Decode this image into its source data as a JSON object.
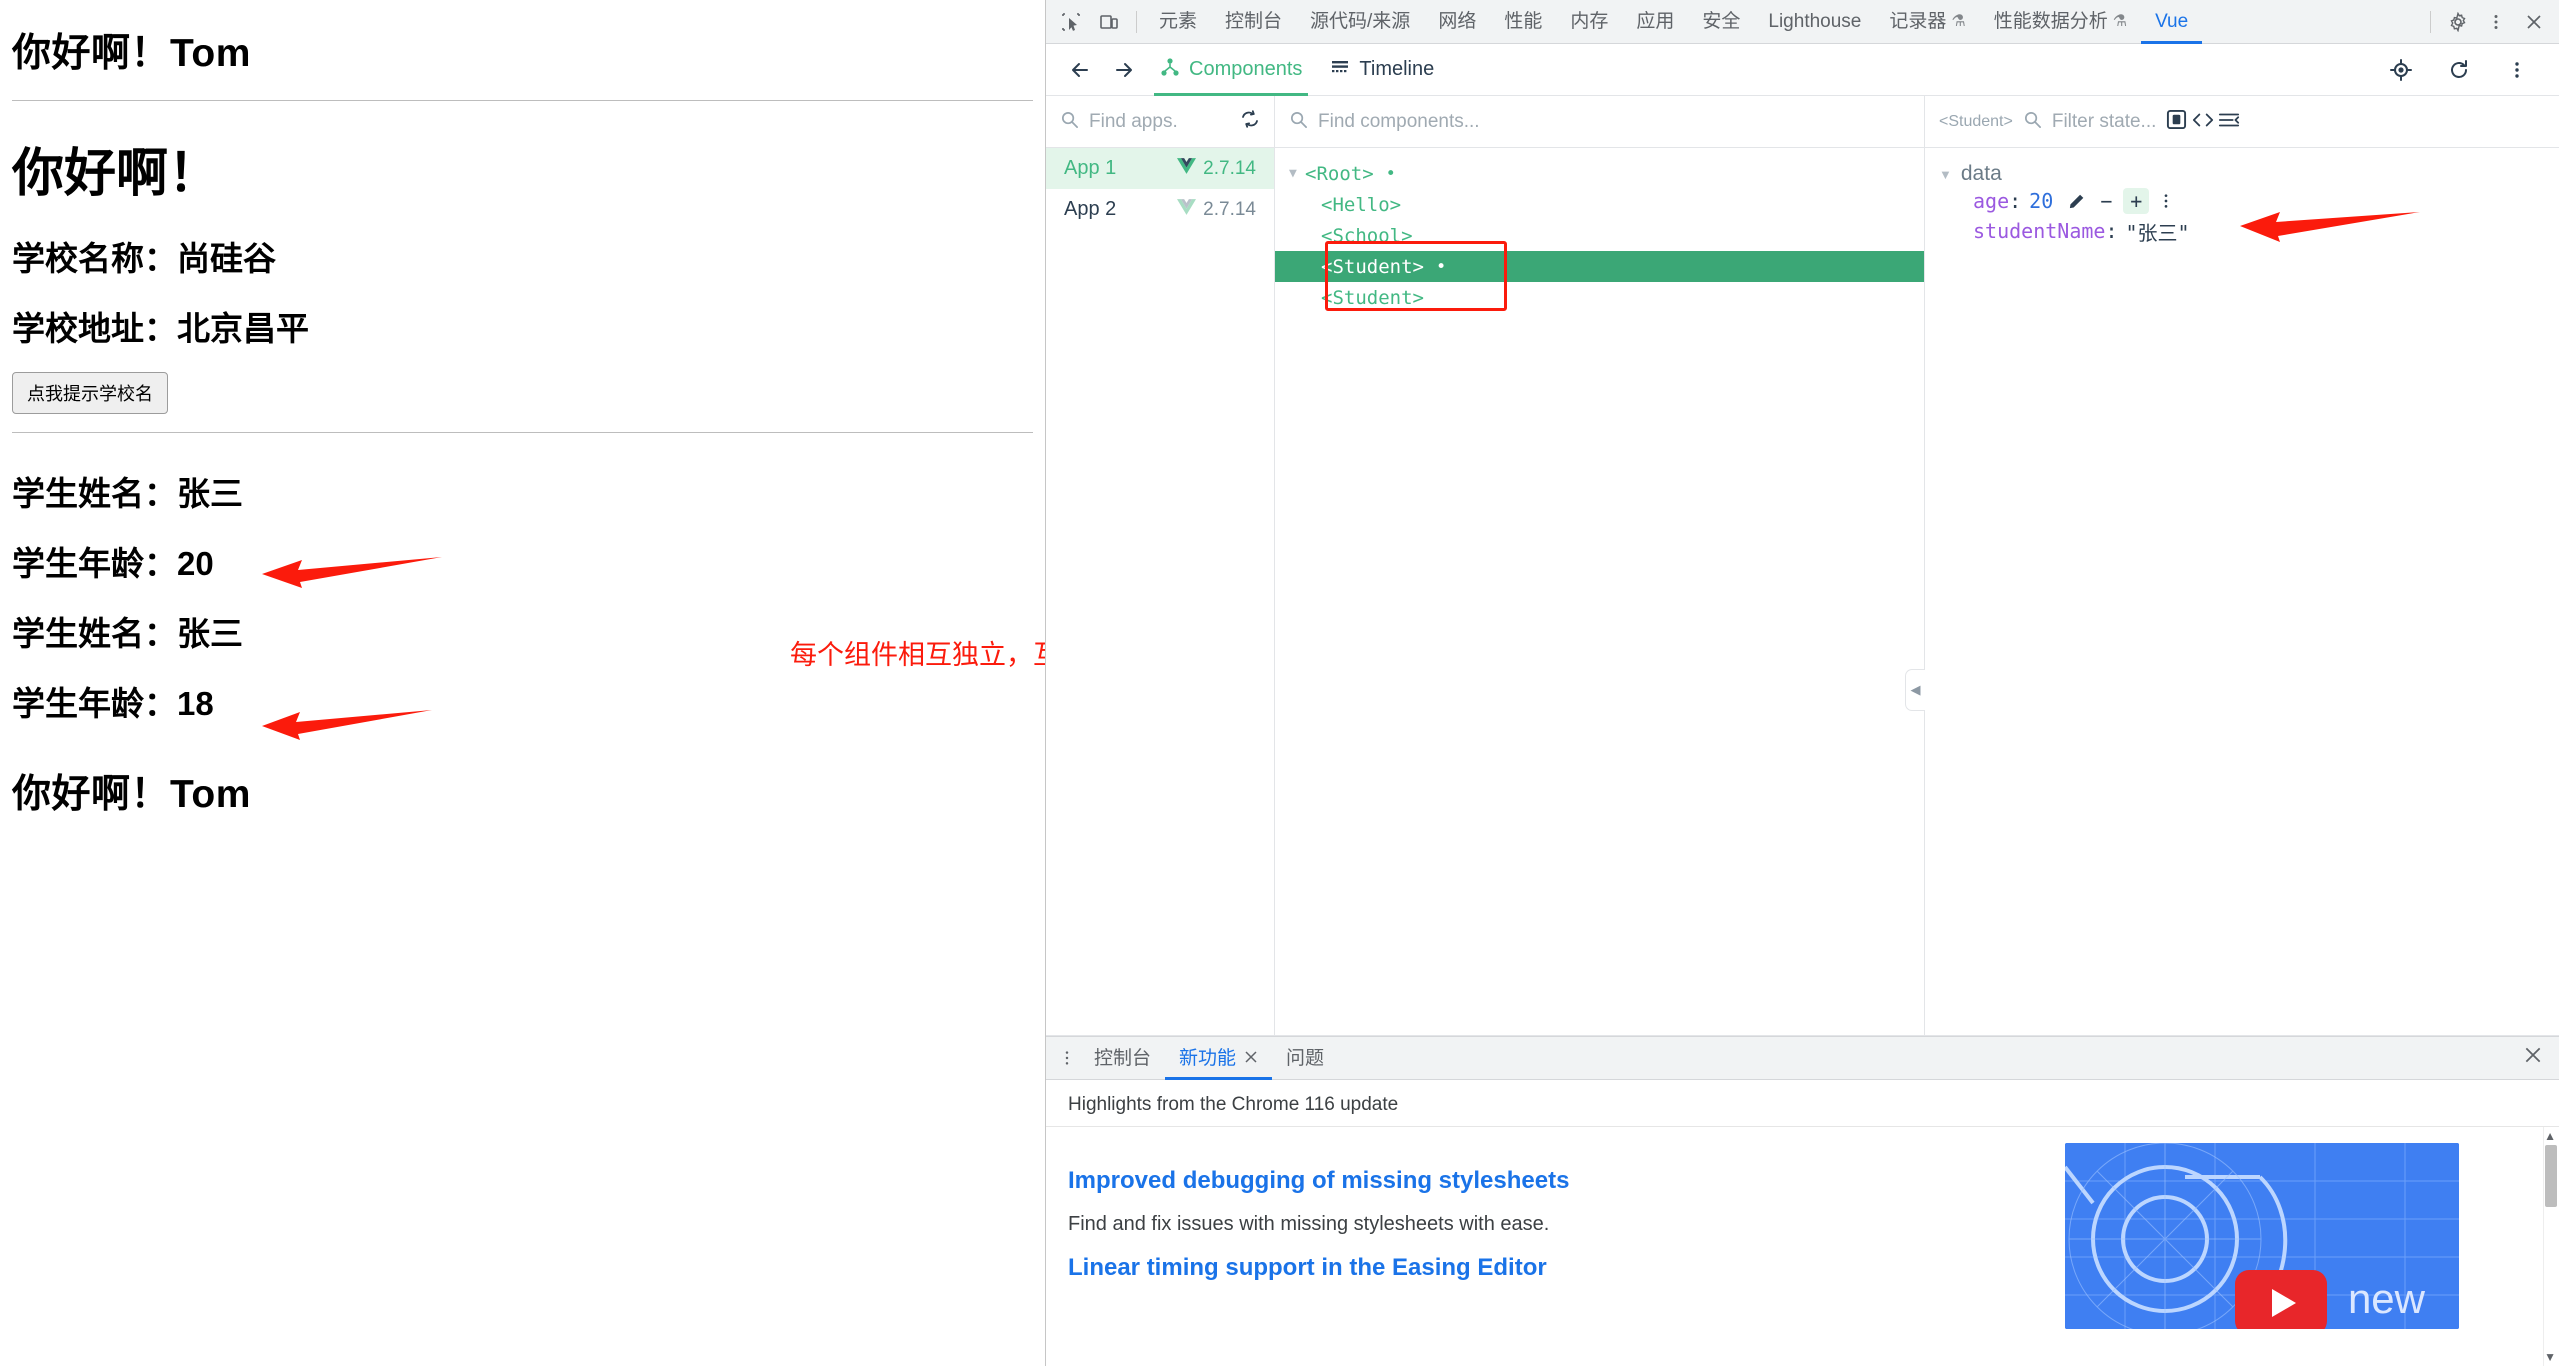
{
  "page": {
    "greeting_top": "你好啊！Tom",
    "hello_title": "你好啊！",
    "school_name": "学校名称：尚硅谷",
    "school_address": "学校地址：北京昌平",
    "school_button": "点我提示学校名",
    "student1_name": "学生姓名：张三",
    "student1_age": "学生年龄：20",
    "student2_name": "学生姓名：张三",
    "student2_age": "学生年龄：18",
    "greeting_bottom": "你好啊！Tom",
    "annotation": "每个组件相互独立，互不影响",
    "annotation_color": "#fb1b0c"
  },
  "devtools": {
    "topbar": {
      "inspect_icon": "inspect-element-icon",
      "device_icon": "device-toolbar-icon",
      "tabs": [
        {
          "label": "元素",
          "active": false
        },
        {
          "label": "控制台",
          "active": false
        },
        {
          "label": "源代码/来源",
          "active": false
        },
        {
          "label": "网络",
          "active": false
        },
        {
          "label": "性能",
          "active": false
        },
        {
          "label": "内存",
          "active": false
        },
        {
          "label": "应用",
          "active": false
        },
        {
          "label": "安全",
          "active": false
        },
        {
          "label": "Lighthouse",
          "active": false
        },
        {
          "label": "记录器",
          "flask": "⚗",
          "active": false
        },
        {
          "label": "性能数据分析",
          "flask": "⚗",
          "active": false
        },
        {
          "label": "Vue",
          "active": true
        }
      ],
      "settings_icon": "gear-icon",
      "more_icon": "more-vertical-icon",
      "close_icon": "close-icon"
    },
    "vuebar": {
      "back_icon": "arrow-left-icon",
      "forward_icon": "arrow-right-icon",
      "tabs": [
        {
          "label": "Components",
          "icon": "component-tree-icon",
          "active": true
        },
        {
          "label": "Timeline",
          "icon": "timeline-icon",
          "active": false
        }
      ],
      "target_icon": "select-component-icon",
      "refresh_icon": "refresh-icon",
      "more_icon": "more-vertical-icon"
    },
    "apps": {
      "search_placeholder": "Find apps.",
      "refresh_icon": "refresh-apps-icon",
      "items": [
        {
          "name": "App 1",
          "version": "2.7.14",
          "selected": true
        },
        {
          "name": "App 2",
          "version": "2.7.14",
          "selected": false
        }
      ]
    },
    "tree": {
      "search_placeholder": "Find components...",
      "nodes": [
        {
          "label": "<Root>",
          "depth": 0,
          "caret": "▼",
          "dot": true,
          "selected": false
        },
        {
          "label": "<Hello>",
          "depth": 1,
          "caret": "",
          "dot": false,
          "selected": false
        },
        {
          "label": "<School>",
          "depth": 1,
          "caret": "",
          "dot": false,
          "selected": false
        },
        {
          "label": "<Student>",
          "depth": 1,
          "caret": "",
          "dot": true,
          "selected": true
        },
        {
          "label": "<Student>",
          "depth": 1,
          "caret": "",
          "dot": false,
          "selected": false
        }
      ],
      "collapse_icon": "collapse-left-icon"
    },
    "state": {
      "component": "<Student>",
      "filter_placeholder": "Filter state...",
      "icons": [
        "screenshot-icon",
        "code-icon",
        "layout-icon"
      ],
      "group_label": "data",
      "rows": [
        {
          "key": "age",
          "value": "20",
          "type": "number",
          "has_editors": true
        },
        {
          "key": "studentName",
          "value": "\"张三\"",
          "type": "string",
          "has_editors": false
        }
      ],
      "edit_icon": "pencil-icon",
      "minus_icon": "minus-icon",
      "plus_icon": "plus-icon",
      "menu_icon": "more-vertical-icon"
    },
    "drawer": {
      "menu_icon": "more-vertical-icon",
      "tabs": [
        {
          "label": "控制台",
          "active": false,
          "closable": false
        },
        {
          "label": "新功能",
          "active": true,
          "closable": true
        },
        {
          "label": "问题",
          "active": false,
          "closable": false
        }
      ],
      "close_icon": "close-icon",
      "subtitle": "Highlights from the Chrome 116 update",
      "items": [
        {
          "title": "Improved debugging of missing stylesheets",
          "desc": "Find and fix issues with missing stylesheets with ease."
        },
        {
          "title": "Linear timing support in the Easing Editor",
          "desc": ""
        }
      ],
      "thumbnail_label": "new",
      "play_icon": "youtube-play-icon"
    }
  }
}
